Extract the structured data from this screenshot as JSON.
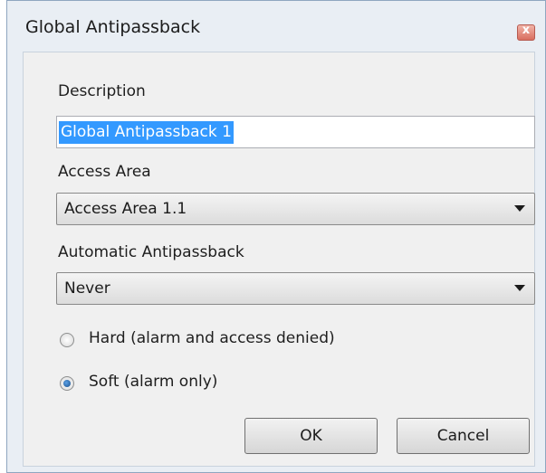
{
  "dialog": {
    "title": "Global Antipassback",
    "close_label": "x"
  },
  "form": {
    "description_label": "Description",
    "description_value": "Global Antipassback 1",
    "access_area_label": "Access Area",
    "access_area_value": "Access Area 1.1",
    "auto_apb_label": "Automatic Antipassback",
    "auto_apb_value": "Never",
    "radio_hard_label": "Hard (alarm and access denied)",
    "radio_soft_label": "Soft (alarm only)",
    "selected_mode": "soft"
  },
  "buttons": {
    "ok_label": "OK",
    "cancel_label": "Cancel"
  }
}
